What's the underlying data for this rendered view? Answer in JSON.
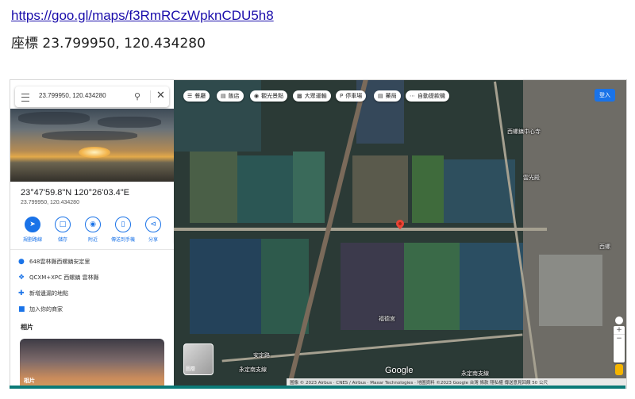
{
  "link": "https://goo.gl/maps/f3RmRCzWpknCDU5h8",
  "coords_line": "座標 23.799950, 120.434280",
  "search": {
    "query": "23.799950, 120.434280"
  },
  "place": {
    "dms": "23°47'59.8\"N 120°26'03.4\"E",
    "decimal": "23.799950, 120.434280"
  },
  "actions": [
    {
      "label": "規劃路線",
      "icon": "directions-icon"
    },
    {
      "label": "儲存",
      "icon": "bookmark-icon"
    },
    {
      "label": "附近",
      "icon": "nearby-icon"
    },
    {
      "label": "傳送到手機",
      "icon": "phone-icon"
    },
    {
      "label": "分享",
      "icon": "share-icon"
    }
  ],
  "info": [
    {
      "text": "648雲林縣西螺鎮安定里",
      "icon": "location-pin-icon"
    },
    {
      "text": "QCXM+XPC 西螺鎮 雲林縣",
      "icon": "plus-code-icon"
    },
    {
      "text": "新增遺漏的地點",
      "icon": "add-place-icon"
    },
    {
      "text": "加入你的商家",
      "icon": "business-icon"
    }
  ],
  "photos": {
    "heading": "相片",
    "thumb_label": "相片"
  },
  "chips": [
    {
      "label": "餐廳",
      "icon": "restaurant-icon"
    },
    {
      "label": "飯店",
      "icon": "hotel-icon"
    },
    {
      "label": "觀光景點",
      "icon": "camera-icon"
    },
    {
      "label": "大眾運輸",
      "icon": "transit-icon"
    },
    {
      "label": "停車場",
      "icon": "parking-icon"
    },
    {
      "label": "藥局",
      "icon": "pharmacy-icon"
    },
    {
      "label": "自動提款機",
      "icon": "more-icon"
    }
  ],
  "login": "登入",
  "map_labels": {
    "label1": "西螺鎮中心寺",
    "label2": "雲光殿",
    "label3": "福德宮",
    "label4": "西螺",
    "road1": "安定路",
    "road2": "永定南支線",
    "road3": "永定南支線",
    "layer": "圖層"
  },
  "attribution": "圖像 © 2023 Airbus · CNES / Airbus · Maxar Technologies · 地圖資料 ©2023 Google   台灣   條款   隱私權   傳送意見回饋   50 公尺",
  "colors": {
    "accent": "#1a73e8",
    "pin": "#ea4335",
    "link": "#1a0dab"
  }
}
